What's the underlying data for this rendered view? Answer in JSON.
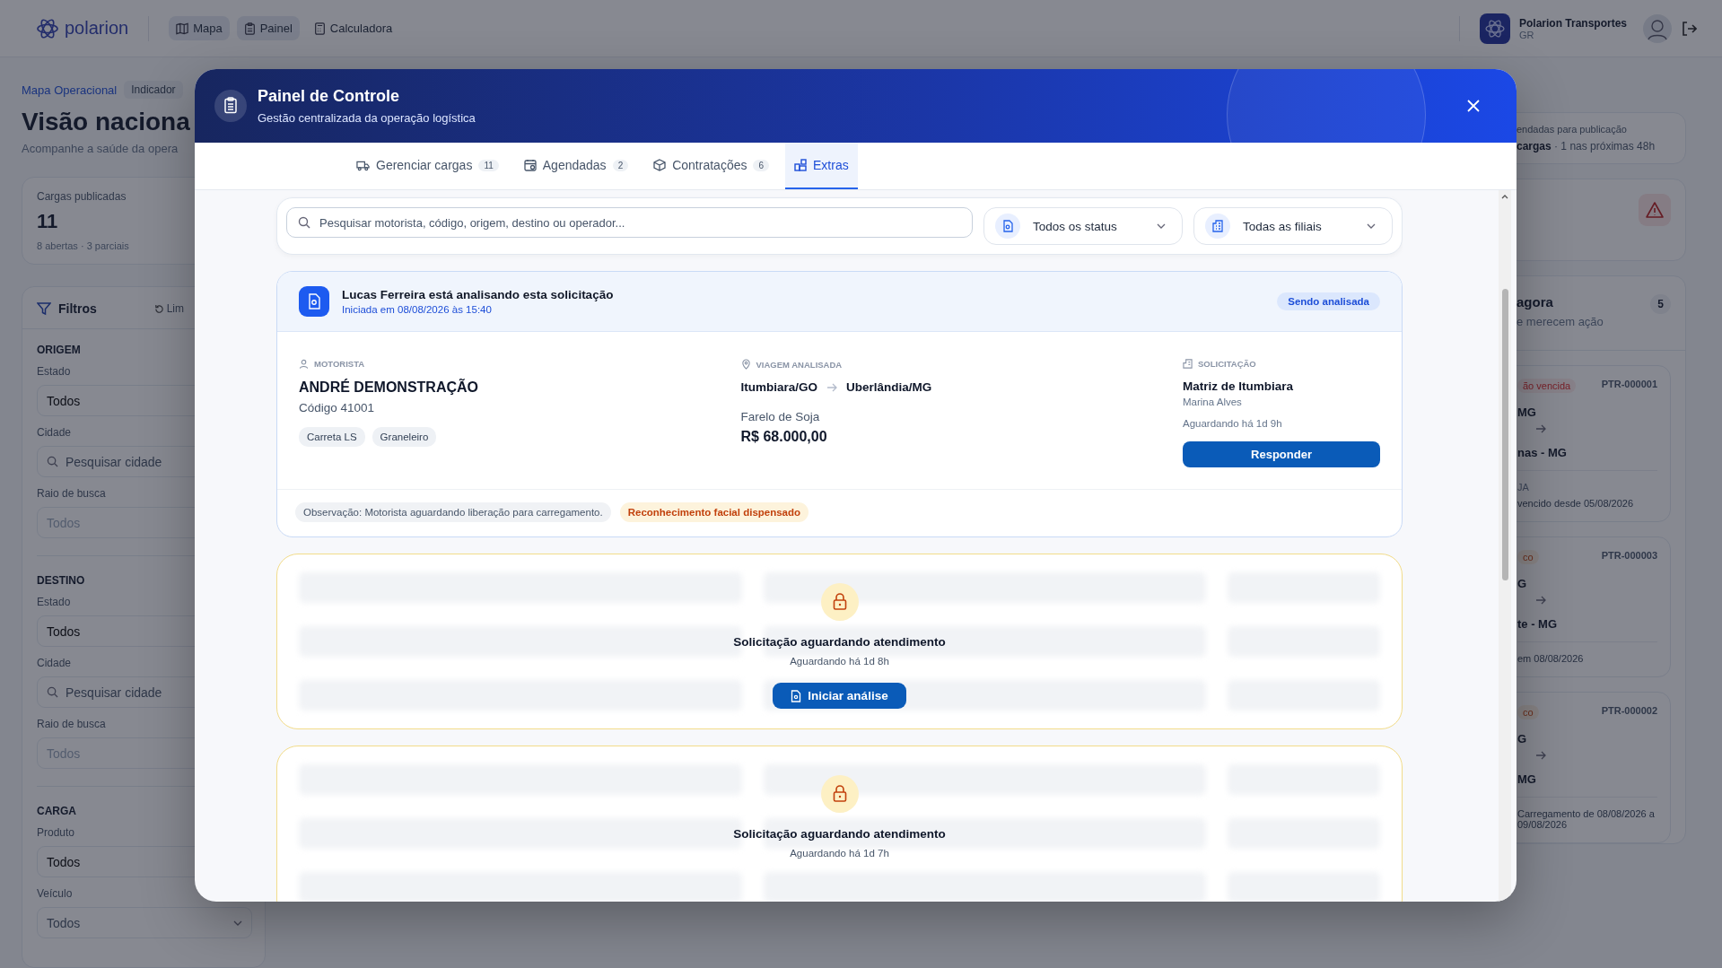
{
  "topbar": {
    "logo": "polarion",
    "nav": [
      {
        "label": "Mapa",
        "selected": true,
        "kind": "map"
      },
      {
        "label": "Painel",
        "selected": true,
        "kind": "clipboard"
      },
      {
        "label": "Calculadora",
        "selected": false,
        "kind": "calculator"
      }
    ],
    "account": {
      "name": "Polarion Transportes",
      "role": "GR"
    }
  },
  "page": {
    "breadcrumb": [
      "Mapa Operacional",
      "Indicador"
    ],
    "title": "Visão naciona",
    "subtitle": "Acompanhe a saúde da opera"
  },
  "stat": {
    "label": "Cargas publicadas",
    "value": "11",
    "detail": "8 abertas · 3 parciais"
  },
  "filters": {
    "title": "Filtros",
    "reset": "Lim",
    "sections": [
      {
        "heading": "ORIGEM",
        "fields": [
          {
            "label": "Estado",
            "value": "Todos",
            "kind": "select"
          },
          {
            "label": "Cidade",
            "placeholder": "Pesquisar cidade",
            "kind": "search"
          },
          {
            "label": "Raio de busca",
            "placeholder": "Todos",
            "kind": "select"
          }
        ]
      },
      {
        "heading": "DESTINO",
        "fields": [
          {
            "label": "Estado",
            "value": "Todos",
            "kind": "select"
          },
          {
            "label": "Cidade",
            "placeholder": "Pesquisar cidade",
            "kind": "search"
          },
          {
            "label": "Raio de busca",
            "placeholder": "Todos",
            "kind": "select"
          }
        ]
      },
      {
        "heading": "CARGA",
        "fields": [
          {
            "label": "Produto",
            "value": "Todos",
            "kind": "select"
          },
          {
            "label": "Veículo",
            "placeholder": "Todos",
            "kind": "dropdown"
          }
        ]
      }
    ]
  },
  "scheduled": {
    "label": "endadas para publicação",
    "value": "cargas",
    "detail": "· 1 nas próximas 48h"
  },
  "attention": {
    "title": "agora",
    "subtitle": "e merecem ação",
    "count": "5",
    "items": [
      {
        "tag": "ão vencida",
        "kind": "overdue",
        "code": "PTR-000001",
        "origin": "MG",
        "destination": "nas - MG",
        "meta": "JA",
        "note": "vencido desde 05/08/2026"
      },
      {
        "tag": "co",
        "kind": "risk",
        "code": "PTR-000003",
        "origin": "G",
        "destination": "te - MG",
        "note": "em 08/08/2026"
      },
      {
        "tag": "co",
        "kind": "risk",
        "code": "PTR-000002",
        "origin": "G",
        "destination": "MG",
        "note": "Carregamento de 08/08/2026 a 09/08/2026"
      }
    ]
  },
  "modal": {
    "title": "Painel de Controle",
    "subtitle": "Gestão centralizada da operação logística",
    "tabs": [
      {
        "label": "Gerenciar cargas",
        "count": "11",
        "selected": false,
        "kind": "truck"
      },
      {
        "label": "Agendadas",
        "count": "2",
        "selected": false,
        "kind": "calendar"
      },
      {
        "label": "Contratações",
        "count": "6",
        "selected": false,
        "kind": "box"
      },
      {
        "label": "Extras",
        "selected": true,
        "kind": "grid"
      }
    ],
    "search": {
      "placeholder": "Pesquisar motorista, código, origem, destino ou operador..."
    },
    "selects": [
      {
        "value": "Todos os status",
        "kind": "status"
      },
      {
        "value": "Todas as filiais",
        "kind": "branch"
      }
    ],
    "active_request": {
      "analyst_message": "Lucas Ferreira está analisando esta solicitação",
      "started": "Iniciada em 08/08/2026 às 15:40",
      "status": "Sendo analisada",
      "driver_heading": "MOTORISTA",
      "driver": "ANDRÉ DEMONSTRAÇÃO",
      "driver_code": "Código 41001",
      "vehicle_tags": [
        "Carreta LS",
        "Graneleiro"
      ],
      "trip_heading": "VIAGEM ANALISADA",
      "origin": "Itumbiara/GO",
      "destination": "Uberlândia/MG",
      "product": "Farelo de Soja",
      "value": "R$ 68.000,00",
      "request_heading": "SOLICITAÇÃO",
      "branch": "Matriz de Itumbiara",
      "requester": "Marina Alves",
      "waiting": "Aguardando há 1d 9h",
      "action": "Responder",
      "notes": [
        {
          "text": "Observação: Motorista aguardando liberação para carregamento.",
          "kind": "info"
        },
        {
          "text": "Reconhecimento facial dispensado",
          "kind": "warning"
        }
      ]
    },
    "locked_requests": [
      {
        "title": "Solicitação aguardando atendimento",
        "waiting": "Aguardando há 1d 8h",
        "action": "Iniciar análise"
      },
      {
        "title": "Solicitação aguardando atendimento",
        "waiting": "Aguardando há 1d 7h"
      }
    ]
  }
}
